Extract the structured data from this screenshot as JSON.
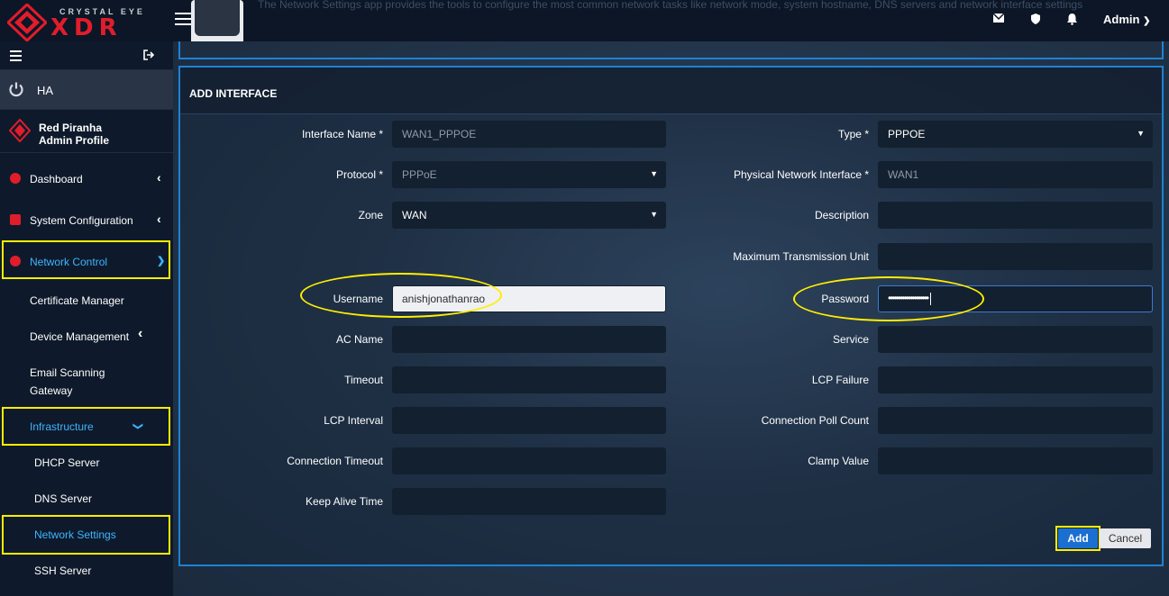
{
  "header": {
    "brand_tagline": "CRYSTAL EYE",
    "brand_name": "XDR",
    "description": "The Network Settings app provides the tools to configure the most common network tasks like network mode, system hostname, DNS servers and network interface settings",
    "admin_label": "Admin",
    "icons": [
      "envelope-icon",
      "shield-icon",
      "bell-icon",
      "chevron-down-icon"
    ]
  },
  "sidebar": {
    "ha_label": "HA",
    "profile_name": "Red Piranha",
    "profile_sub": "Admin Profile",
    "items": {
      "dashboard": "Dashboard",
      "system_configuration": "System Configuration",
      "network_control": "Network Control",
      "certificate_manager": "Certificate Manager",
      "device_management": "Device Management",
      "email_scanning_1": "Email Scanning",
      "email_scanning_2": "Gateway",
      "infrastructure": "Infrastructure",
      "dhcp_server": "DHCP Server",
      "dns_server": "DNS Server",
      "network_settings": "Network Settings",
      "ssh_server": "SSH Server"
    }
  },
  "form": {
    "title": "ADD INTERFACE",
    "left": {
      "interface_name_label": "Interface Name *",
      "interface_name_value": "WAN1_PPPOE",
      "protocol_label": "Protocol *",
      "protocol_value": "PPPoE",
      "zone_label": "Zone",
      "zone_value": "WAN",
      "username_label": "Username",
      "username_value": "anishjonathanrao",
      "ac_name_label": "AC Name",
      "timeout_label": "Timeout",
      "lcp_interval_label": "LCP Interval",
      "connection_timeout_label": "Connection Timeout",
      "keep_alive_label": "Keep Alive Time"
    },
    "right": {
      "type_label": "Type *",
      "type_value": "PPPOE",
      "physical_label": "Physical Network Interface *",
      "physical_value": "WAN1",
      "description_label": "Description",
      "mtu_label": "Maximum Transmission Unit",
      "password_label": "Password",
      "password_value": "••••••••••••••••••••",
      "service_label": "Service",
      "lcp_failure_label": "LCP Failure",
      "poll_count_label": "Connection Poll Count",
      "clamp_label": "Clamp Value"
    },
    "add_label": "Add",
    "cancel_label": "Cancel"
  },
  "colors": {
    "accent_blue": "#1d82d4",
    "highlight_yellow": "#ffee00",
    "brand_red": "#e11d2b",
    "active_link": "#3fb4ff"
  }
}
